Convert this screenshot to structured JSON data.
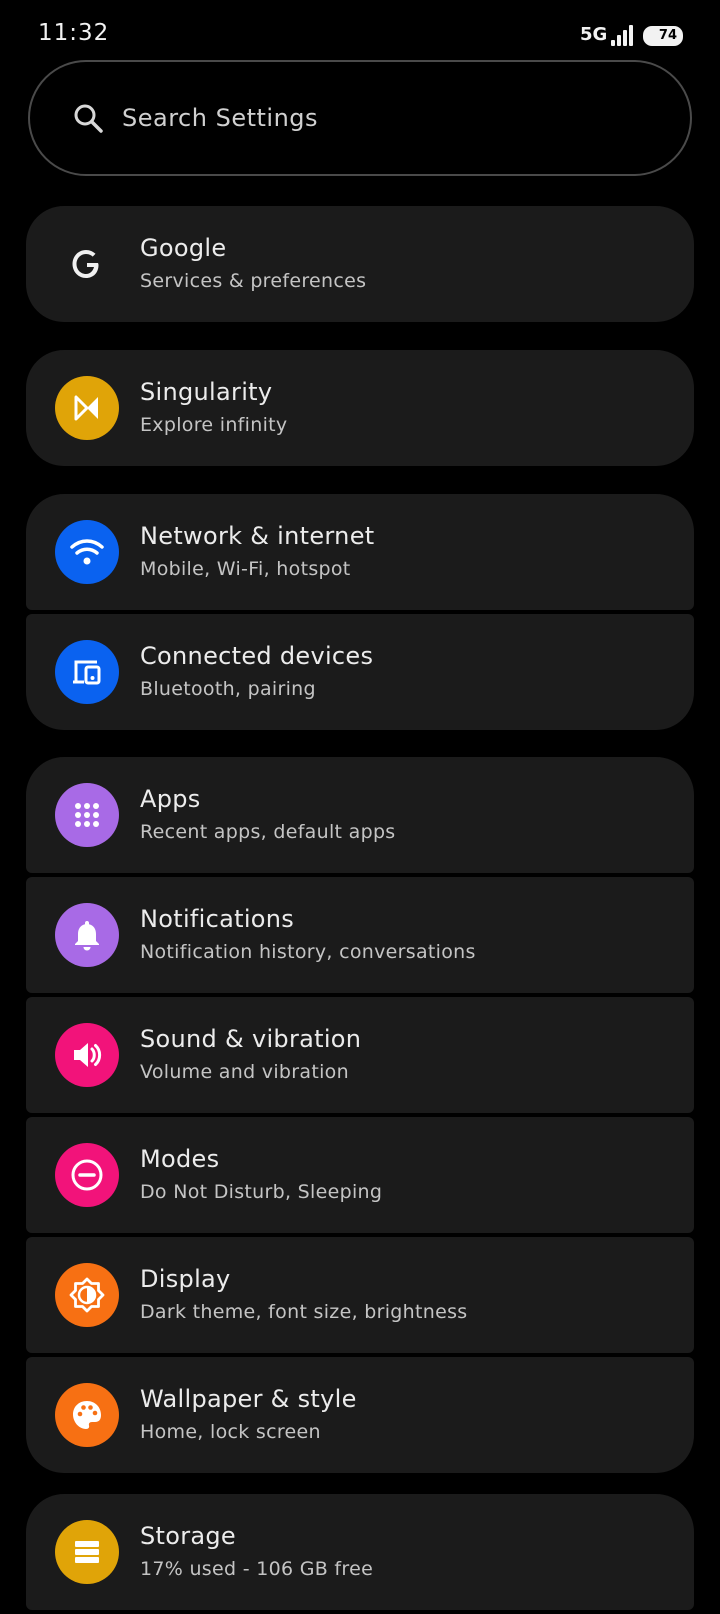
{
  "status": {
    "time": "11:32",
    "network": "5G",
    "battery": "74"
  },
  "search": {
    "placeholder": "Search Settings"
  },
  "colors": {
    "background": "#000000",
    "card": "#1b1b1b",
    "singularity": "#e0a408",
    "blue": "#0a62f0",
    "purple": "#a86ae6",
    "pink": "#f2137a",
    "orange": "#f77013"
  },
  "items": [
    {
      "title": "Google",
      "subtitle": "Services & preferences",
      "icon": "google-icon"
    },
    {
      "title": "Singularity",
      "subtitle": "Explore infinity",
      "icon": "singularity-icon"
    },
    {
      "title": "Network & internet",
      "subtitle": "Mobile, Wi-Fi, hotspot",
      "icon": "wifi-icon"
    },
    {
      "title": "Connected devices",
      "subtitle": "Bluetooth, pairing",
      "icon": "devices-icon"
    },
    {
      "title": "Apps",
      "subtitle": "Recent apps, default apps",
      "icon": "apps-grid-icon"
    },
    {
      "title": "Notifications",
      "subtitle": "Notification history, conversations",
      "icon": "bell-icon"
    },
    {
      "title": "Sound & vibration",
      "subtitle": "Volume and vibration",
      "icon": "speaker-icon"
    },
    {
      "title": "Modes",
      "subtitle": "Do Not Disturb, Sleeping",
      "icon": "minus-circle-icon"
    },
    {
      "title": "Display",
      "subtitle": "Dark theme, font size, brightness",
      "icon": "brightness-icon"
    },
    {
      "title": "Wallpaper & style",
      "subtitle": "Home, lock screen",
      "icon": "palette-icon"
    },
    {
      "title": "Storage",
      "subtitle": "17% used - 106 GB free",
      "icon": "storage-icon"
    }
  ]
}
